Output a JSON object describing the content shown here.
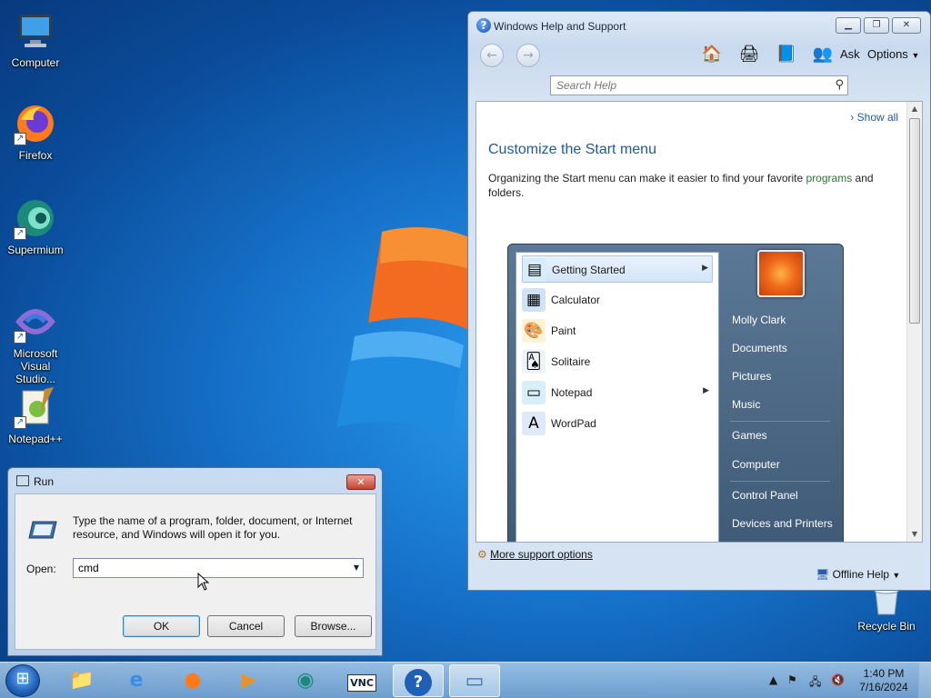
{
  "desktop": {
    "icons": [
      {
        "label": "Computer",
        "icon": "computer-icon"
      },
      {
        "label": "Firefox",
        "icon": "firefox-icon"
      },
      {
        "label": "Supermium",
        "icon": "supermium-icon"
      },
      {
        "label": "Microsoft Visual Studio...",
        "icon": "visual-studio-icon"
      },
      {
        "label": "Notepad++",
        "icon": "notepadpp-icon"
      },
      {
        "label": "Recycle Bin",
        "icon": "recycle-bin-icon"
      }
    ]
  },
  "help_window": {
    "title": "Windows Help and Support",
    "toolbar": {
      "ask": "Ask",
      "options": "Options"
    },
    "search_placeholder": "Search Help",
    "show_all": "Show all",
    "heading": "Customize the Start menu",
    "para_before": "Organizing the Start menu can make it easier to find your favorite ",
    "para_link": "programs",
    "para_after": " and folders.",
    "start_menu": {
      "left_items": [
        {
          "label": "Getting Started",
          "icon": "getting-started-icon",
          "submenu": true
        },
        {
          "label": "Calculator",
          "icon": "calculator-icon",
          "submenu": false
        },
        {
          "label": "Paint",
          "icon": "paint-icon",
          "submenu": false
        },
        {
          "label": "Solitaire",
          "icon": "solitaire-icon",
          "submenu": false
        },
        {
          "label": "Notepad",
          "icon": "notepad-icon",
          "submenu": true
        },
        {
          "label": "WordPad",
          "icon": "wordpad-icon",
          "submenu": false
        }
      ],
      "right_items": [
        "Molly Clark",
        "Documents",
        "Pictures",
        "Music",
        "Games",
        "Computer",
        "Control Panel",
        "Devices and Printers"
      ]
    },
    "more_support": "More support options",
    "offline_help": "Offline Help"
  },
  "run_dialog": {
    "title": "Run",
    "description": "Type the name of a program, folder, document, or Internet resource, and Windows will open it for you.",
    "open_label": "Open:",
    "open_value": "cmd",
    "ok": "OK",
    "cancel": "Cancel",
    "browse": "Browse..."
  },
  "taskbar": {
    "apps": [
      "explorer-icon",
      "internet-explorer-icon",
      "firefox-icon",
      "media-player-icon",
      "supermium-icon",
      "vnc-icon",
      "help-icon",
      "run-icon"
    ],
    "time": "1:40 PM",
    "date": "7/16/2024"
  },
  "colors": {
    "accent": "#1e5aa0",
    "link_green": "#2a7a2a",
    "taskbar": "#8fb6dc"
  }
}
